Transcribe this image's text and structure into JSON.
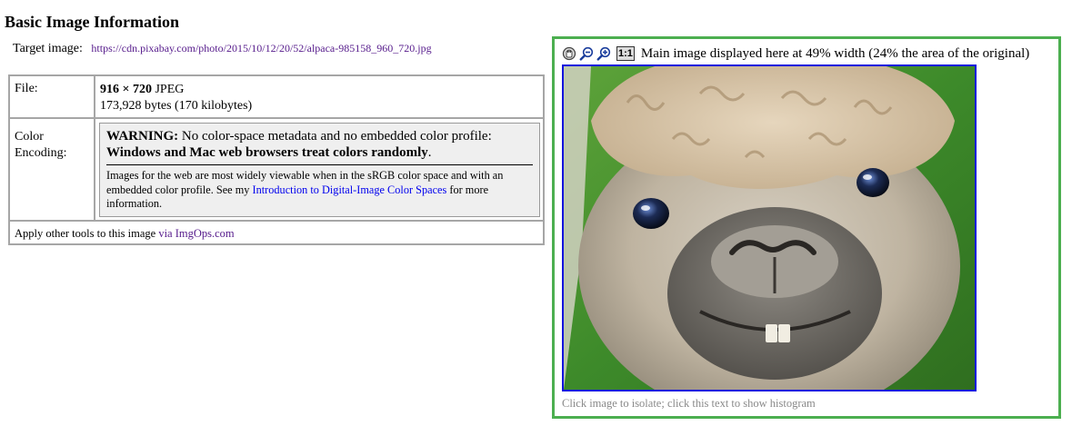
{
  "header": {
    "title": "Basic Image Information"
  },
  "target": {
    "label": "Target image:",
    "url": "https://cdn.pixabay.com/photo/2015/10/12/20/52/alpaca-985158_960_720.jpg"
  },
  "file": {
    "label": "File:",
    "dimensions": "916 × 720",
    "format": " JPEG",
    "size": "173,928 bytes (170 kilobytes)"
  },
  "color_encoding": {
    "label_line1": "Color",
    "label_line2": "Encoding:",
    "warning_bold": "WARNING:",
    "warning_text": " No color-space metadata and no embedded color profile:",
    "warning_line2": "Windows and Mac web browsers treat colors randomly",
    "warning_period": ".",
    "body_text": "Images for the web are most widely viewable when in the sRGB color space and with an embedded color profile. See my ",
    "link_text": "Introduction to Digital-Image Color Spaces",
    "body_tail": " for more information."
  },
  "tools": {
    "prefix": "Apply other tools to this image ",
    "link_text": "via ImgOps.com"
  },
  "viewer": {
    "toolbar": {
      "reset_icon": "hand-reset-icon",
      "zoom_out_icon": "zoom-out-icon",
      "zoom_in_icon": "zoom-in-icon",
      "actual_size_label": "1:1"
    },
    "display_note": "Main image displayed here at 49% width (24% the area of the original)",
    "caption": "Click image to isolate; click this text to show histogram",
    "image_subject": "alpaca-photo"
  },
  "colors": {
    "viewer_border": "#4caf50",
    "image_border": "#1010dd",
    "table_border": "#a6a6a6",
    "warning_bg": "#efefef",
    "link": "#0000ee",
    "visited_link": "#551a8b"
  }
}
